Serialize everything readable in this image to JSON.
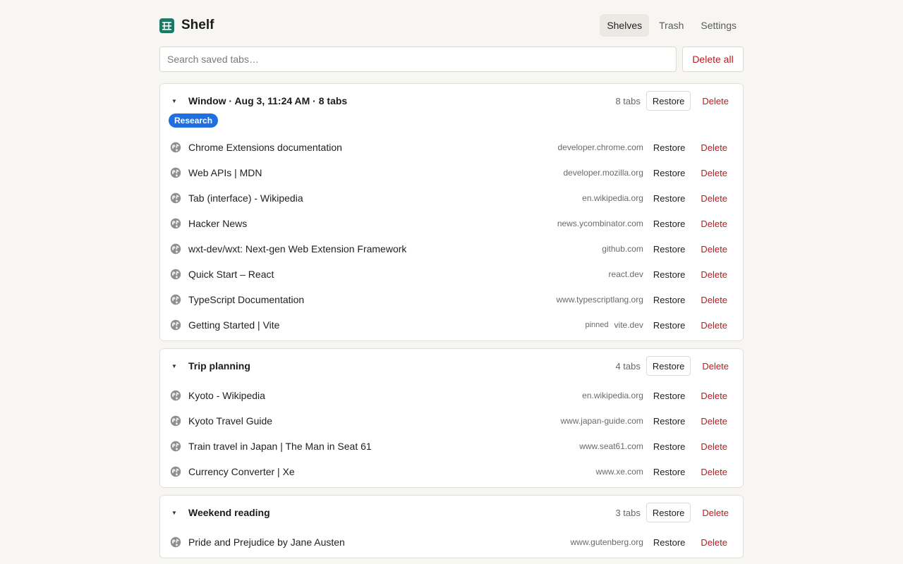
{
  "app": {
    "name": "Shelf",
    "accent": "#1a7a68"
  },
  "nav": {
    "items": [
      "Shelves",
      "Trash",
      "Settings"
    ],
    "active": "Shelves"
  },
  "search": {
    "placeholder": "Search saved tabs…",
    "value": ""
  },
  "actions": {
    "delete_all": "Delete all",
    "restore": "Restore",
    "delete": "Delete"
  },
  "shelves": [
    {
      "title": "Window · Aug 3, 11:24 AM · 8 tabs",
      "count": "8 tabs",
      "tag": "Research",
      "tabs": [
        {
          "title": "Chrome Extensions documentation",
          "domain": "developer.chrome.com"
        },
        {
          "title": "Web APIs | MDN",
          "domain": "developer.mozilla.org"
        },
        {
          "title": "Tab (interface) - Wikipedia",
          "domain": "en.wikipedia.org"
        },
        {
          "title": "Hacker News",
          "domain": "news.ycombinator.com"
        },
        {
          "title": "wxt-dev/wxt: Next-gen Web Extension Framework",
          "domain": "github.com"
        },
        {
          "title": "Quick Start – React",
          "domain": "react.dev"
        },
        {
          "title": "TypeScript Documentation",
          "domain": "www.typescriptlang.org"
        },
        {
          "title": "Getting Started | Vite",
          "domain": "vite.dev",
          "pinned": "pinned"
        }
      ]
    },
    {
      "title": "Trip planning",
      "count": "4 tabs",
      "tabs": [
        {
          "title": "Kyoto - Wikipedia",
          "domain": "en.wikipedia.org"
        },
        {
          "title": "Kyoto Travel Guide",
          "domain": "www.japan-guide.com"
        },
        {
          "title": "Train travel in Japan | The Man in Seat 61",
          "domain": "www.seat61.com"
        },
        {
          "title": "Currency Converter | Xe",
          "domain": "www.xe.com"
        }
      ]
    },
    {
      "title": "Weekend reading",
      "count": "3 tabs",
      "tabs": [
        {
          "title": "Pride and Prejudice by Jane Austen",
          "domain": "www.gutenberg.org"
        }
      ]
    }
  ]
}
